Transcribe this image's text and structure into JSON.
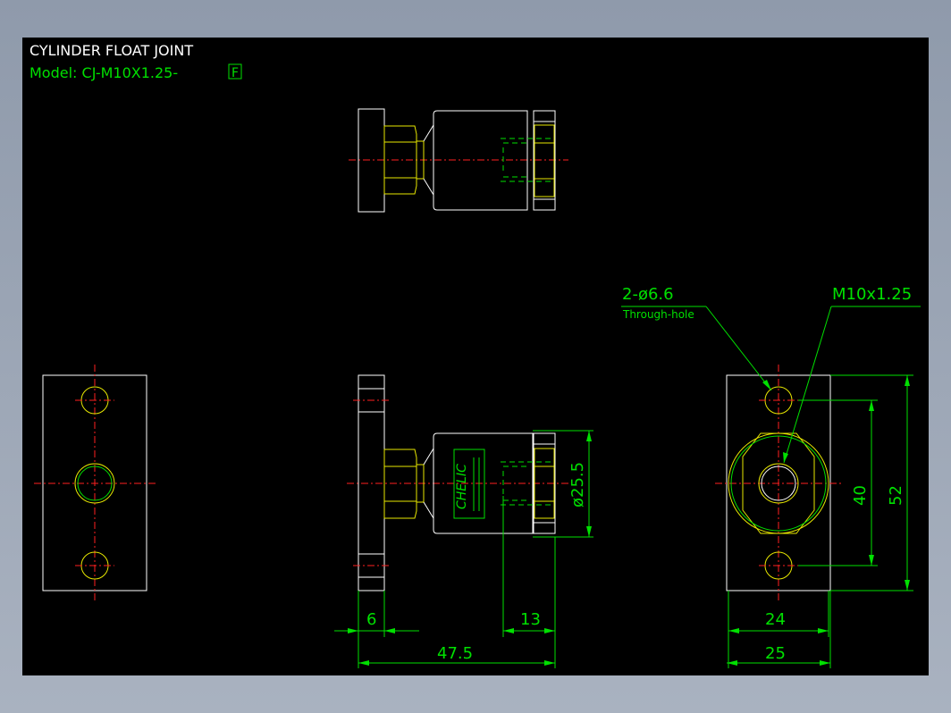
{
  "title": "CYLINDER  FLOAT  JOINT",
  "model_label": "Model:  CJ-M10X1.25-",
  "model_suffix": "F",
  "callout_holes": "2-ø6.6",
  "callout_holes_note": "Through-hole",
  "callout_thread": "M10x1.25",
  "dim_plate_thickness": "6",
  "dim_thread_depth": "13",
  "dim_overall_length": "47.5",
  "dim_body_diameter": "ø25.5",
  "dim_hole_pitch": "40",
  "dim_plate_height": "52",
  "dim_hex_width": "24",
  "dim_plate_width": "25",
  "logo_text": "CHELIC",
  "colors": {
    "outline": "#ffffff",
    "part": "#e8e800",
    "dimension": "#00e000",
    "centerline": "#ff2020",
    "background": "#000000"
  }
}
